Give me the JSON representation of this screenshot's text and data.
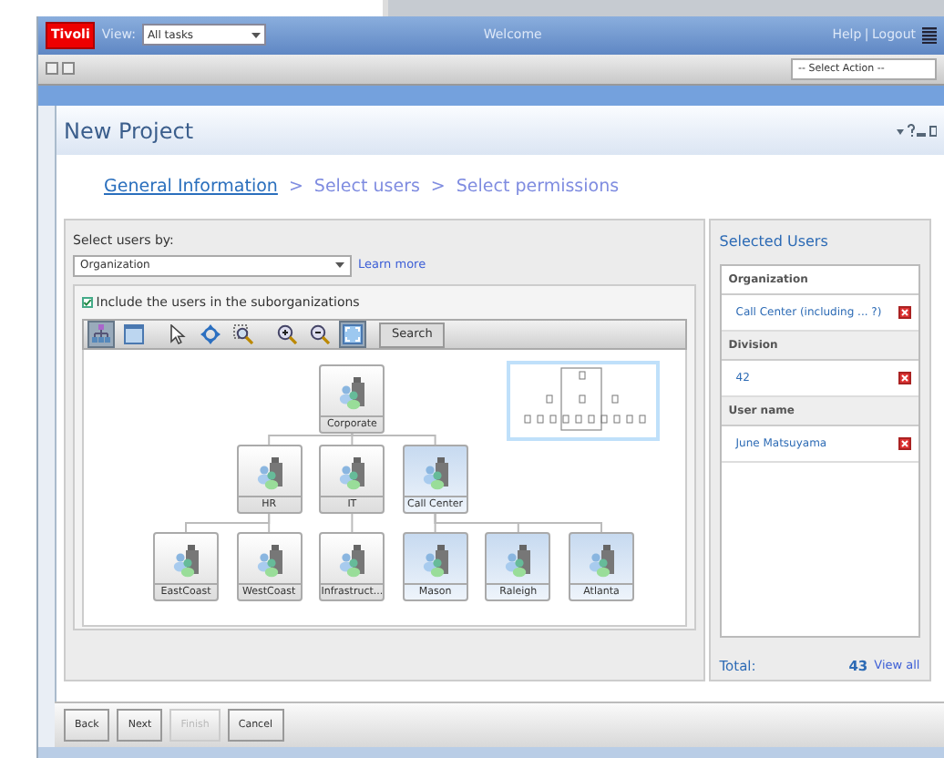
{
  "header": {
    "logo": "Tivoli",
    "view_label": "View:",
    "view_value": "All tasks",
    "welcome": "Welcome",
    "links": [
      "Help",
      "Logout"
    ],
    "link_separator": "|"
  },
  "toolbar": {
    "action_select": "-- Select Action --"
  },
  "portlet": {
    "title": "New Project"
  },
  "steps": [
    {
      "label": "General Information",
      "selected": true
    },
    {
      "label": "Select users",
      "selected": false
    },
    {
      "label": "Select permissions",
      "selected": false
    }
  ],
  "separators": [
    ">",
    ">"
  ],
  "select_by": {
    "label": "Select users by:",
    "value": "Organization",
    "link": "Learn more"
  },
  "include_sub": {
    "label": "Include the users in the suborganizations",
    "checked": true
  },
  "chart_toolbar": {
    "tools": [
      {
        "kind": "org",
        "selected": true
      },
      {
        "kind": "panel",
        "selected": false
      },
      {
        "kind": "pointer",
        "selected": false
      },
      {
        "kind": "pan",
        "selected": false
      },
      {
        "kind": "zoomarea",
        "selected": false
      },
      {
        "kind": "zoomin",
        "selected": false
      },
      {
        "kind": "zoomout",
        "selected": false
      },
      {
        "kind": "fit",
        "selected": true
      }
    ],
    "search": "Search"
  },
  "org_tree": {
    "label": "Corporate",
    "selected": false,
    "children": [
      {
        "label": "HR",
        "selected": false,
        "children": [
          {
            "label": "EastCoast",
            "selected": false
          },
          {
            "label": "WestCoast",
            "selected": false
          }
        ]
      },
      {
        "label": "IT",
        "selected": false,
        "children": [
          {
            "label": "Infrastruct...",
            "selected": false
          }
        ]
      },
      {
        "label": "Call Center",
        "selected": true,
        "children": [
          {
            "label": "Mason",
            "selected": true
          },
          {
            "label": "Raleigh",
            "selected": true
          },
          {
            "label": "Atlanta",
            "selected": true
          }
        ]
      }
    ]
  },
  "selected_users": {
    "title": "Selected Users",
    "groups": [
      {
        "heading": "Organization",
        "items": [
          "Call Center (including ... ?)"
        ]
      },
      {
        "heading": "Division",
        "items": [
          "42"
        ]
      },
      {
        "heading": "User name",
        "items": [
          "June Matsuyama"
        ]
      }
    ],
    "total_label": "Total:",
    "total": "43",
    "view_all": "View all"
  },
  "buttons": [
    {
      "label": "Back",
      "disabled": false
    },
    {
      "label": "Next",
      "disabled": false
    },
    {
      "label": "Finish",
      "disabled": true
    },
    {
      "label": "Cancel",
      "disabled": false
    }
  ]
}
